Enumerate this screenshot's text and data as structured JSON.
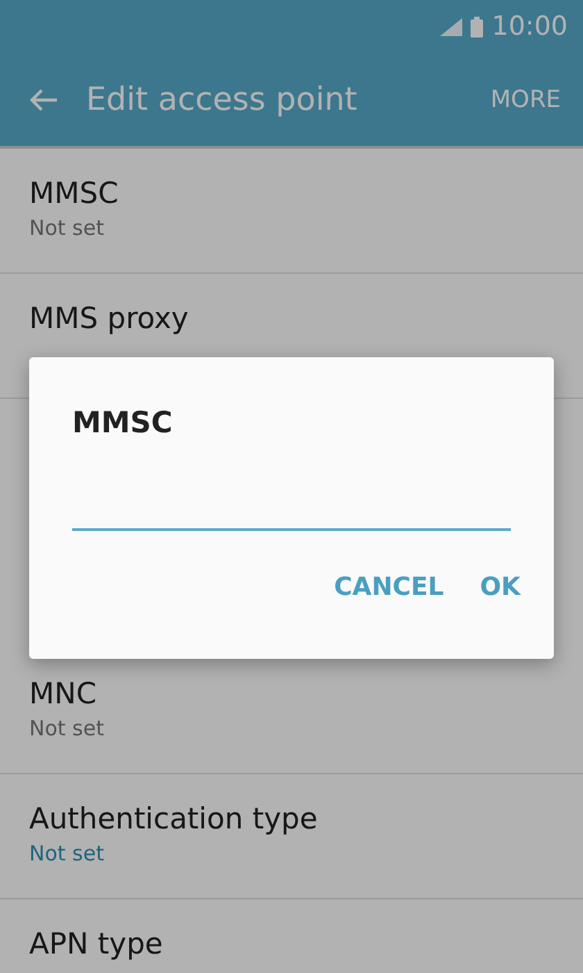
{
  "status_bar": {
    "time": "10:00"
  },
  "app_bar": {
    "title": "Edit access point",
    "action": "MORE"
  },
  "rows_above": [
    {
      "title": "MMSC",
      "value": "Not set",
      "highlighted": false
    },
    {
      "title": "MMS proxy"
    }
  ],
  "rows_below": [
    {
      "title": "MNC",
      "value": "Not set",
      "highlighted": false
    },
    {
      "title": "Authentication type",
      "value": "Not set",
      "highlighted": true
    },
    {
      "title": "APN type"
    }
  ],
  "dialog": {
    "title": "MMSC",
    "buttons": [
      "CANCEL",
      "OK"
    ]
  }
}
